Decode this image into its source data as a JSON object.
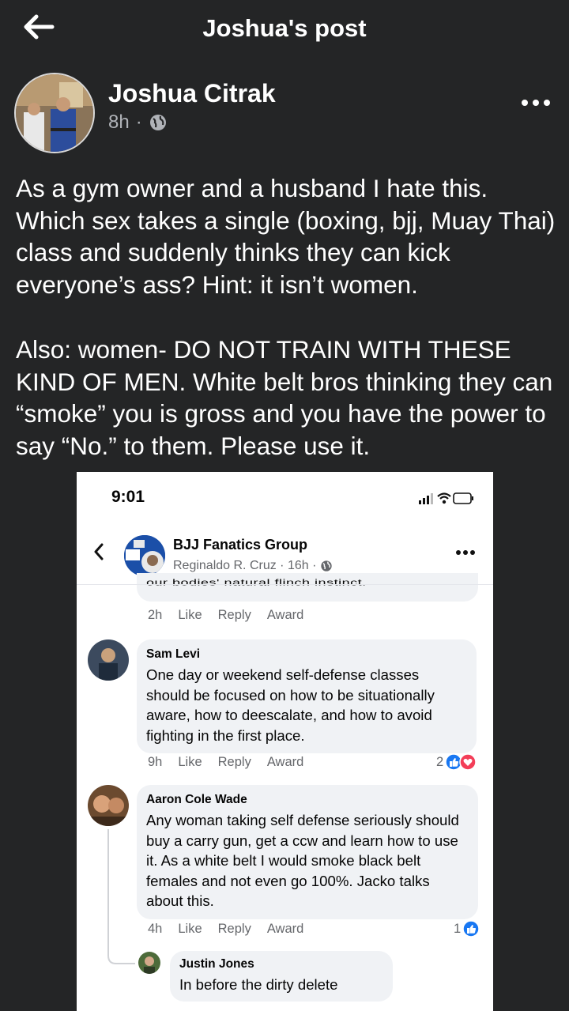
{
  "header": {
    "title": "Joshua's post"
  },
  "post": {
    "author": "Joshua Citrak",
    "time": "8h",
    "paragraphs": [
      "As a gym owner and a husband I hate this. Which sex takes a single (boxing, bjj, Muay Thai) class and suddenly thinks they can kick everyone’s ass? Hint: it isn’t women.",
      "Also: women- DO NOT TRAIN WITH THESE KIND OF MEN. White belt bros thinking they can “smoke” you is gross and you have the power to say “No.” to them. Please use it."
    ]
  },
  "screenshot": {
    "status_time": "9:01",
    "group_name": "BJJ Fanatics Group",
    "group_sub": "Reginaldo R. Cruz · 16h ·",
    "cut_text": "our bodies' natural flinch instinct.",
    "first_actions": {
      "time": "2h",
      "like": "Like",
      "reply": "Reply",
      "award": "Award"
    },
    "comments": [
      {
        "name": "Sam Levi",
        "text": "One day or weekend self-defense classes should be focused on how to be situationally aware, how to deescalate, and how to avoid fighting in the first place.",
        "time": "9h",
        "like": "Like",
        "reply": "Reply",
        "award": "Award",
        "reaction_count": "2"
      },
      {
        "name": "Aaron Cole Wade",
        "text": "Any woman taking self defense seriously should buy a carry gun, get a ccw and learn how to use it.  As a white belt I would smoke black belt females and not even go 100%. Jacko talks about this.",
        "time": "4h",
        "like": "Like",
        "reply": "Reply",
        "award": "Award",
        "reaction_count": "1"
      },
      {
        "name": "Justin Jones",
        "text": "In before the dirty delete"
      }
    ]
  },
  "colors": {
    "bg": "#242526",
    "muted": "#b0b3b8",
    "like_blue": "#1877f2",
    "love_red": "#f33e58"
  },
  "icons": [
    "back-arrow-icon",
    "globe-icon",
    "more-icon",
    "signal-icon",
    "wifi-icon",
    "battery-icon",
    "like-reaction-icon",
    "love-reaction-icon"
  ]
}
